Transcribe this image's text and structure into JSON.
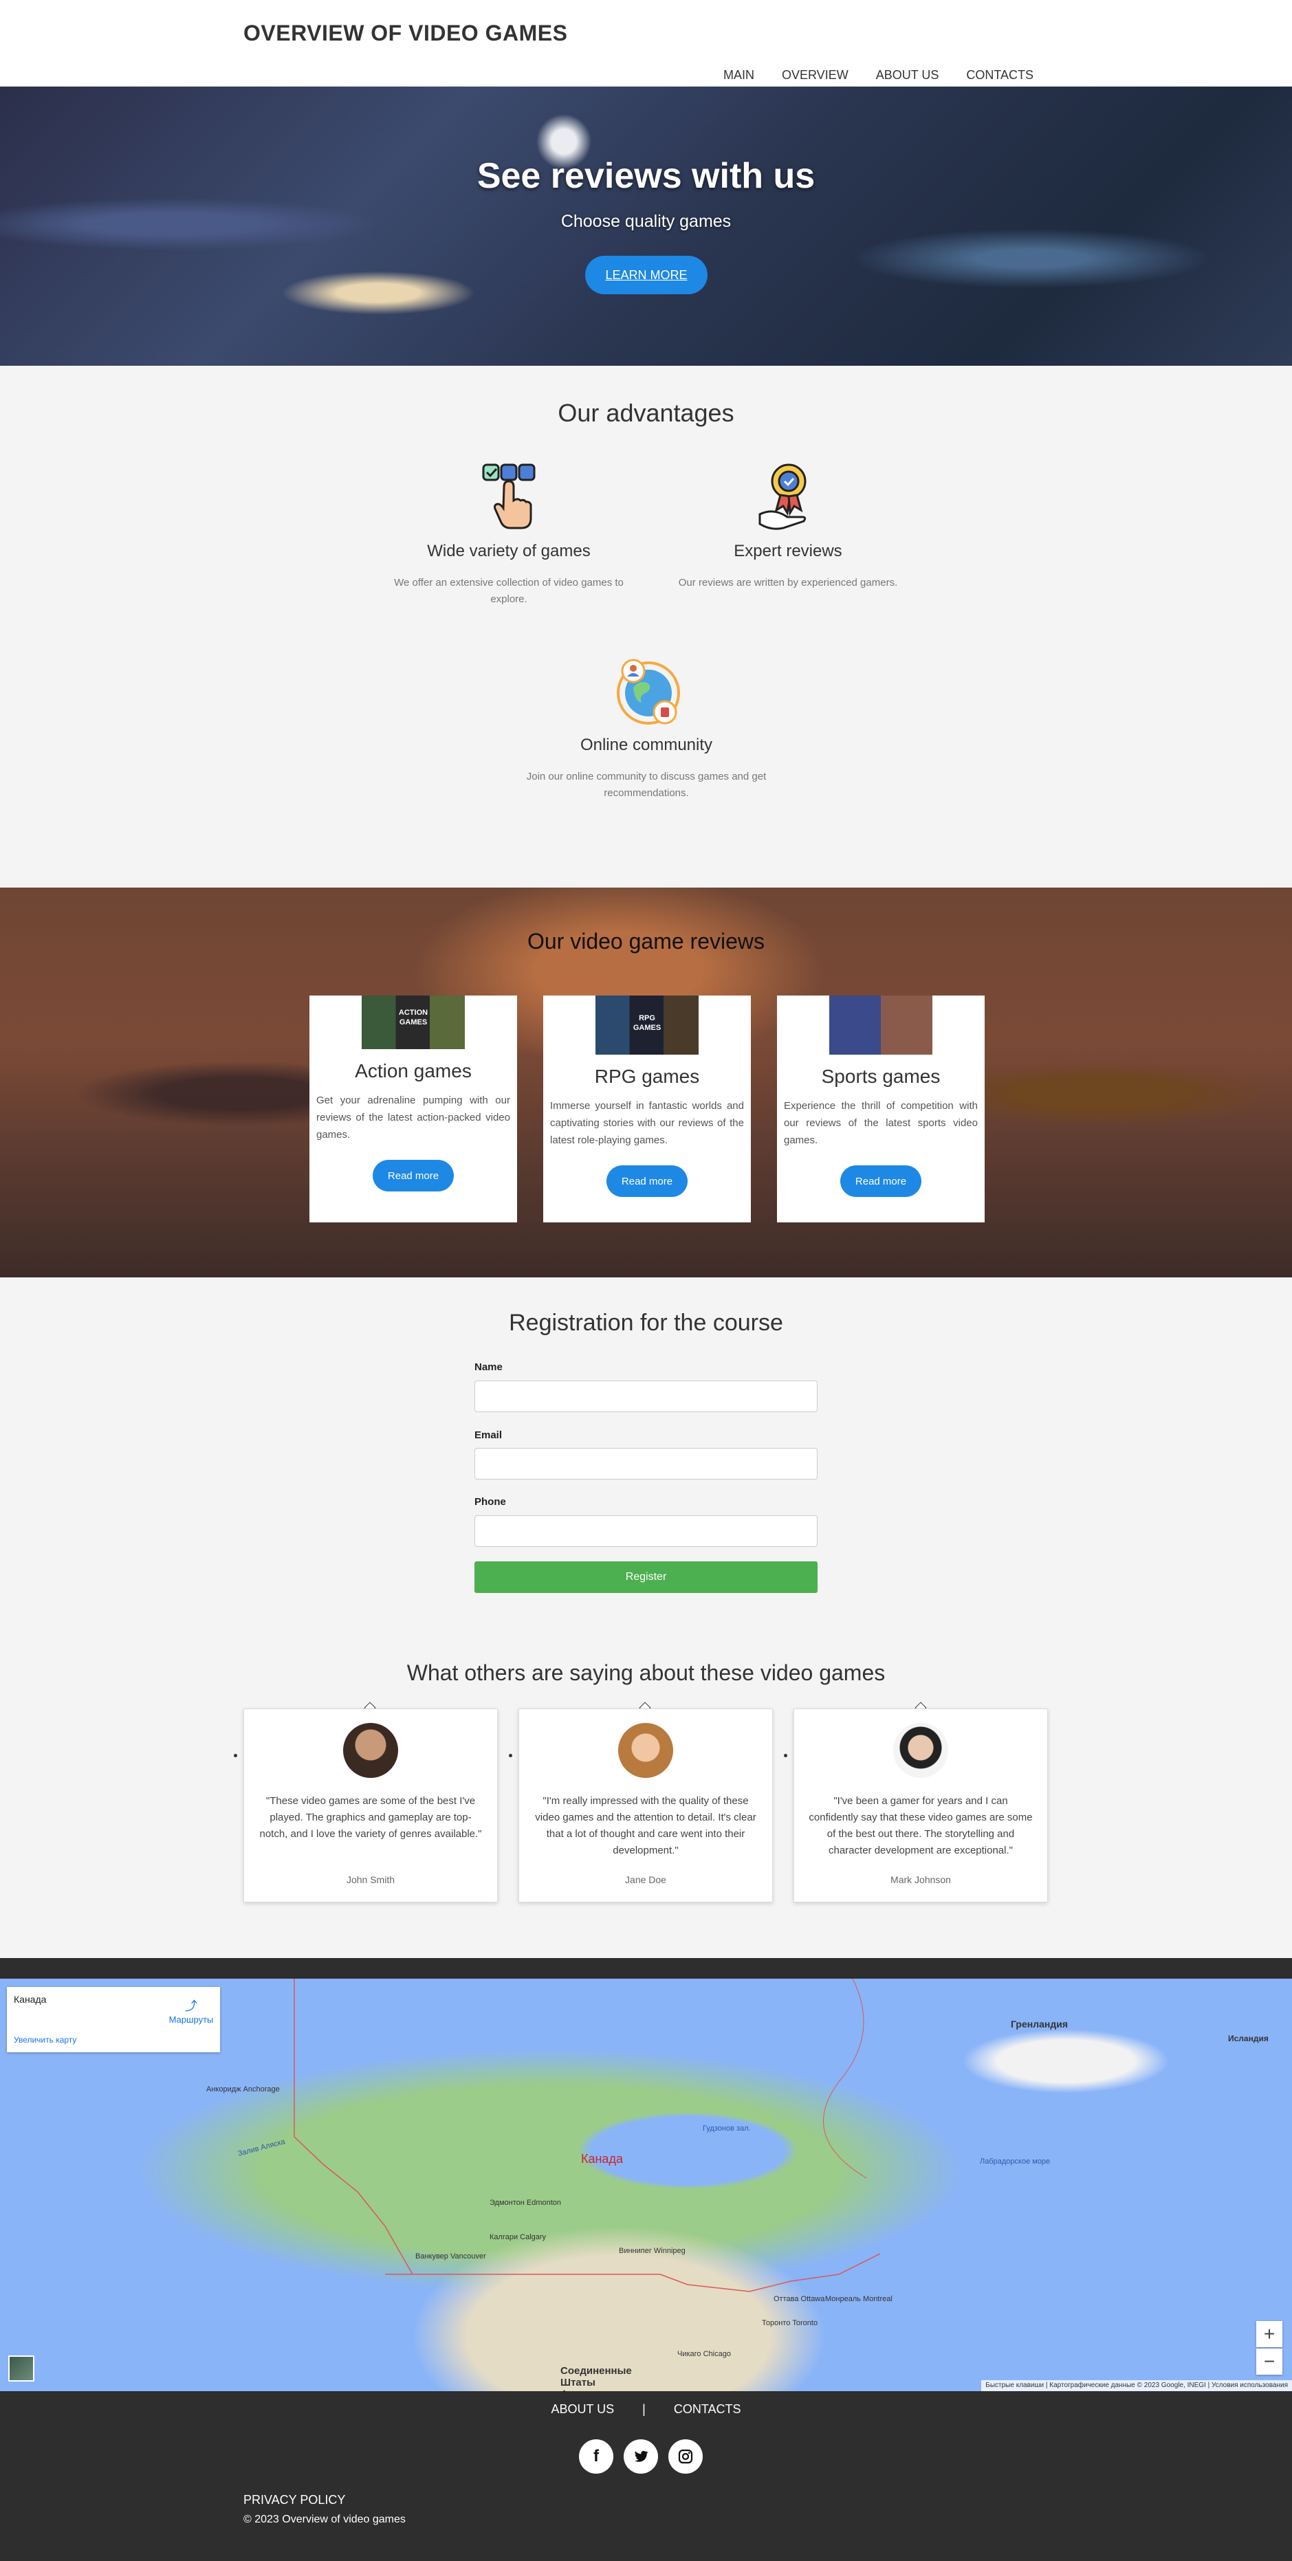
{
  "header": {
    "title": "OVERVIEW OF VIDEO GAMES",
    "nav": [
      "MAIN",
      "OVERVIEW",
      "ABOUT US",
      "CONTACTS"
    ]
  },
  "hero": {
    "title": "See reviews with us",
    "subtitle": "Choose quality games",
    "button": "LEARN MORE"
  },
  "advantages": {
    "title": "Our advantages",
    "items": [
      {
        "icon": "selection-hand-icon",
        "title": "Wide variety of games",
        "text": "We offer an extensive collection of video games to explore."
      },
      {
        "icon": "award-medal-icon",
        "title": "Expert reviews",
        "text": "Our reviews are written by experienced gamers."
      },
      {
        "icon": "globe-community-icon",
        "title": "Online community",
        "text": "Join our online community to discuss games and get recommendations."
      }
    ]
  },
  "reviews": {
    "title": "Our video game reviews",
    "cards": [
      {
        "thumb_label": "ACTION GAMES",
        "title": "Action games",
        "text": "Get your adrenaline pumping with our reviews of the latest action-packed video games.",
        "button": "Read more"
      },
      {
        "thumb_label": "RPG GAMES",
        "title": "RPG games",
        "text": "Immerse yourself in fantastic worlds and captivating stories with our reviews of the latest role-playing games.",
        "button": "Read more"
      },
      {
        "thumb_label": "",
        "title": "Sports games",
        "text": "Experience the thrill of competition with our reviews of the latest sports video games.",
        "button": "Read more"
      }
    ]
  },
  "registration": {
    "title": "Registration for the course",
    "fields": [
      {
        "label": "Name",
        "value": ""
      },
      {
        "label": "Email",
        "value": ""
      },
      {
        "label": "Phone",
        "value": ""
      }
    ],
    "button": "Register"
  },
  "testimonials": {
    "title": "What others are saying about these video games",
    "items": [
      {
        "quote": "\"These video games are some of the best I've played. The graphics and gameplay are top-notch, and I love the variety of genres available.\"",
        "author": "John Smith"
      },
      {
        "quote": "\"I'm really impressed with the quality of these video games and the attention to detail. It's clear that a lot of thought and care went into their development.\"",
        "author": "Jane Doe"
      },
      {
        "quote": "\"I've been a gamer for years and I can confidently say that these video games are some of the best out there. The storytelling and character development are exceptional.\"",
        "author": "Mark Johnson"
      }
    ]
  },
  "map": {
    "place": "Канада",
    "routes": "Маршруты",
    "enlarge": "Увеличить карту",
    "country_label": "Канада",
    "labels": {
      "greenland": "Гренландия",
      "iceland": "Исландия",
      "hudson_bay": "Гудзонов зал.",
      "labrador_sea": "Лабрадорское море",
      "gulf_alaska": "Залив Аляска",
      "edmonton": "Эдмонтон Edmonton",
      "calgary": "Калгари Calgary",
      "vancouver": "Ванкувер Vancouver",
      "winnipeg": "Виннипег Winnipeg",
      "ottawa": "Оттава Ottawa",
      "montreal": "Монреаль Montreal",
      "toronto": "Торонто Toronto",
      "chicago": "Чикаго Chicago",
      "usa": "Соединенные Штаты Америки",
      "anchorage": "Анкоридж Anchorage"
    },
    "zoom_in": "+",
    "zoom_out": "−",
    "footer": [
      "Быстрые клавиши",
      "Картографические данные © 2023 Google, INEGI",
      "Условия использования"
    ]
  },
  "footer": {
    "links": [
      "ABOUT US",
      "CONTACTS"
    ],
    "separator": "|",
    "social": [
      {
        "icon": "facebook-icon",
        "glyph": "f"
      },
      {
        "icon": "twitter-icon",
        "glyph": "🐦"
      },
      {
        "icon": "instagram-icon",
        "glyph": "◎"
      }
    ],
    "privacy": "PRIVACY POLICY",
    "copyright": "© 2023 Overview of video games"
  },
  "colors": {
    "accent": "#1e88e5",
    "register": "#4caf50",
    "footer_bg": "#2e2e2e"
  }
}
